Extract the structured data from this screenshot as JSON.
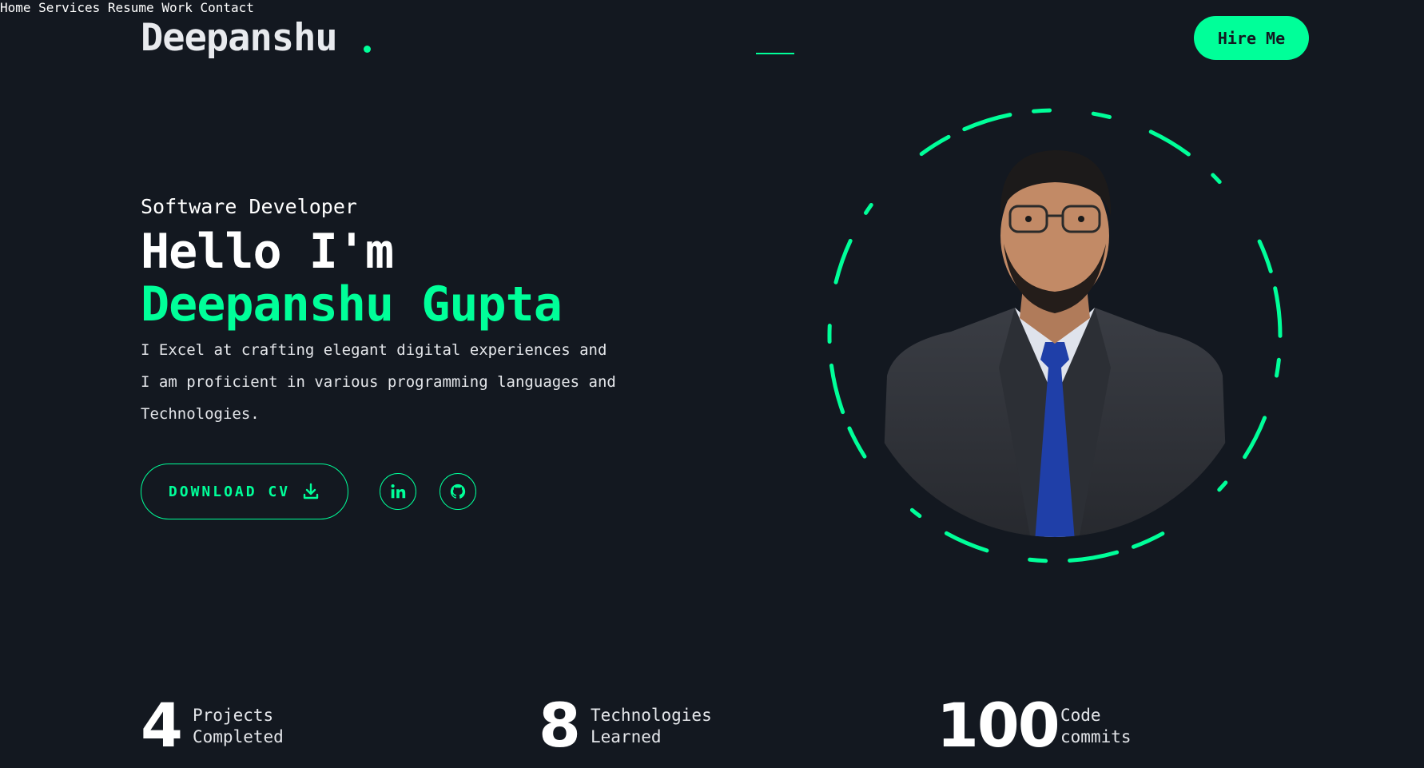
{
  "header": {
    "logo": "Deepanshu",
    "nav": [
      "Home",
      "Services",
      "Resume",
      "Work",
      "Contact"
    ],
    "active_nav": "Home",
    "hire_label": "Hire Me"
  },
  "hero": {
    "role": "Software Developer",
    "greeting": "Hello I'm",
    "name": "Deepanshu Gupta",
    "description_lines": [
      "I Excel at crafting elegant digital experiences and",
      "I am proficient in various programming languages and",
      "Technologies."
    ],
    "cv_label": "DOWNLOAD CV",
    "socials": [
      "linkedin-icon",
      "github-icon"
    ]
  },
  "stats": [
    {
      "value": "4",
      "label_line1": "Projects",
      "label_line2": "Completed"
    },
    {
      "value": "8",
      "label_line1": "Technologies",
      "label_line2": "Learned"
    },
    {
      "value": "100",
      "label_line1": "Code",
      "label_line2": "commits"
    }
  ],
  "colors": {
    "background": "#131820",
    "accent": "#00ff99",
    "text": "#ffffff"
  }
}
